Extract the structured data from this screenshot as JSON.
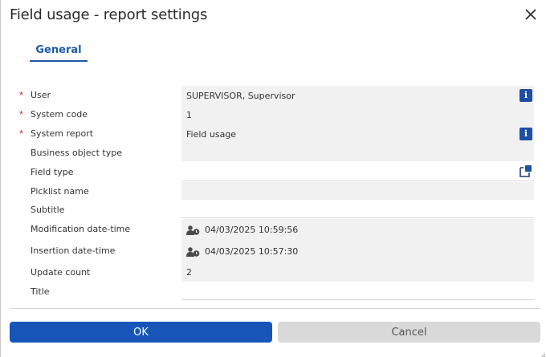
{
  "dialog": {
    "title": "Field usage - report settings",
    "close_icon": "close-icon"
  },
  "tabs": [
    {
      "label": "General",
      "active": true
    }
  ],
  "fields": [
    {
      "label": "User",
      "required": true,
      "value": "SUPERVISOR, Supervisor",
      "icon": "info-icon"
    },
    {
      "label": "System code",
      "required": true,
      "value": "1"
    },
    {
      "label": "System report",
      "required": true,
      "value": "Field usage",
      "icon": "info-icon"
    },
    {
      "label": "Business object type",
      "required": false,
      "value": ""
    },
    {
      "label": "Field type",
      "required": false,
      "value": "",
      "icon": "open-popup-icon"
    },
    {
      "label": "Picklist name",
      "required": false,
      "value": ""
    },
    {
      "label": "Subtitle",
      "required": false,
      "value": ""
    },
    {
      "label": "Modification date-time",
      "required": false,
      "value": "04/03/2025 10:59:56",
      "icon": "user-clock-icon"
    },
    {
      "label": "Insertion date-time",
      "required": false,
      "value": "04/03/2025 10:57:30",
      "icon": "user-clock-icon"
    },
    {
      "label": "Update count",
      "required": false,
      "value": "2"
    },
    {
      "label": "Title",
      "required": false,
      "value": ""
    }
  ],
  "info_glyph": "i",
  "required_marker": "*",
  "buttons": {
    "ok_label": "OK",
    "cancel_label": "Cancel"
  },
  "colors": {
    "accent": "#1756b8",
    "required": "#d03030",
    "field_background": "#f1f1f1"
  }
}
